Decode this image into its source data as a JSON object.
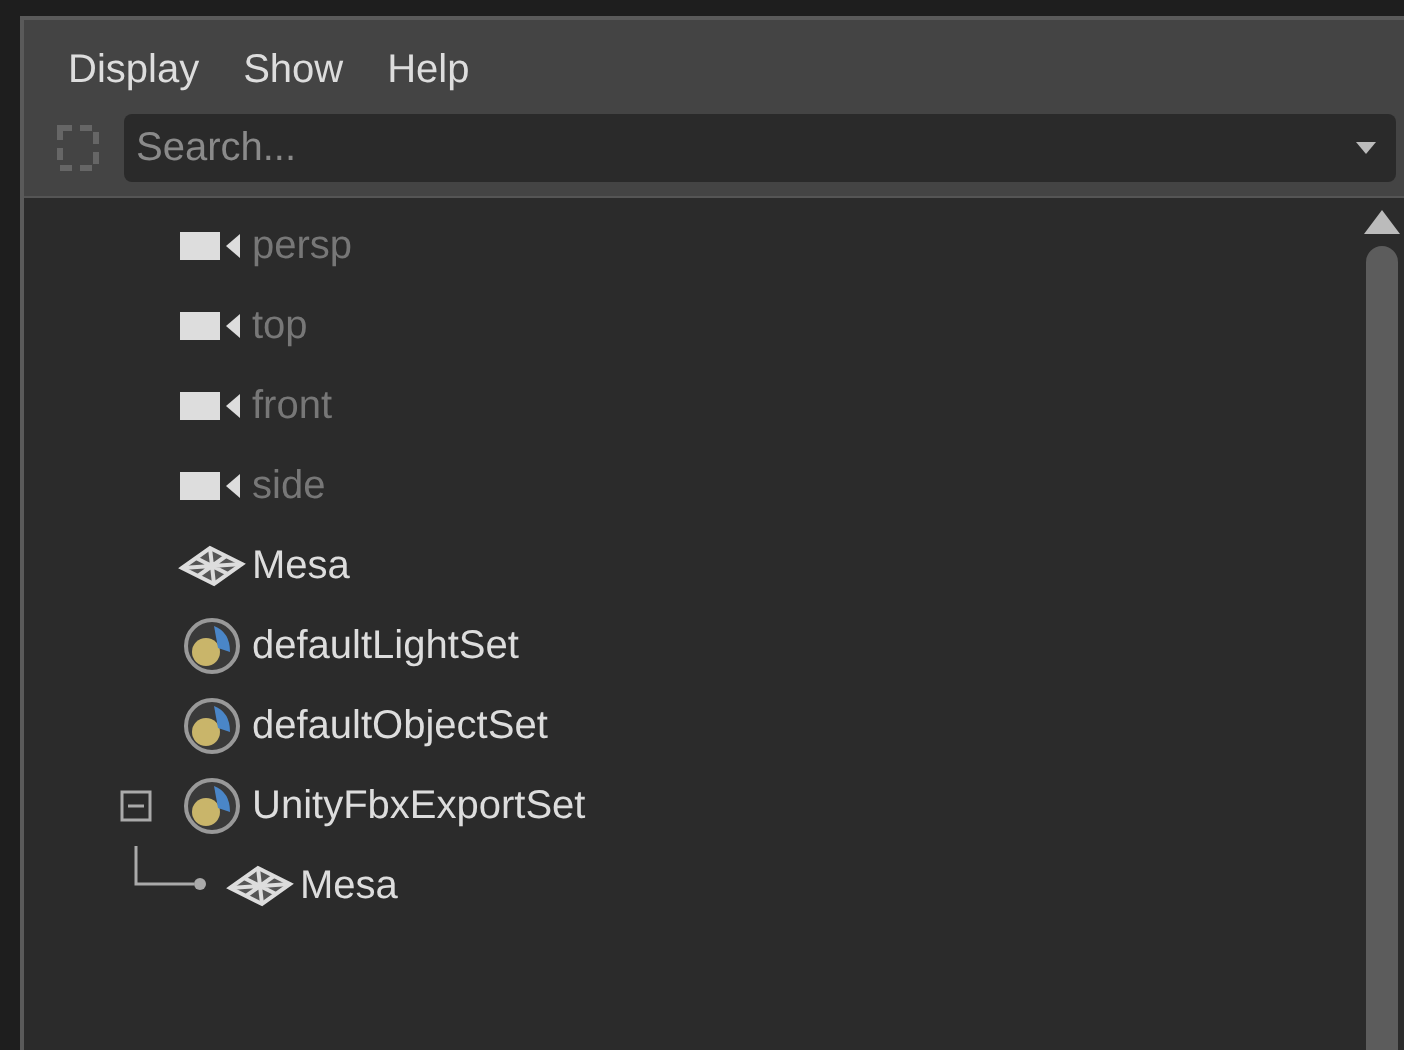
{
  "menu": [
    {
      "label": "Display"
    },
    {
      "label": "Show"
    },
    {
      "label": "Help"
    }
  ],
  "search": {
    "placeholder": "Search..."
  },
  "tree": [
    {
      "label": "persp",
      "kind": "camera",
      "dimmed": true
    },
    {
      "label": "top",
      "kind": "camera",
      "dimmed": true
    },
    {
      "label": "front",
      "kind": "camera",
      "dimmed": true
    },
    {
      "label": "side",
      "kind": "camera",
      "dimmed": true
    },
    {
      "label": "Mesa",
      "kind": "mesh",
      "dimmed": false
    },
    {
      "label": "defaultLightSet",
      "kind": "set",
      "dimmed": false
    },
    {
      "label": "defaultObjectSet",
      "kind": "set",
      "dimmed": false
    },
    {
      "label": "UnityFbxExportSet",
      "kind": "set",
      "dimmed": false,
      "expanded": true,
      "children": [
        {
          "label": "Mesa",
          "kind": "mesh",
          "dimmed": false
        }
      ]
    }
  ]
}
